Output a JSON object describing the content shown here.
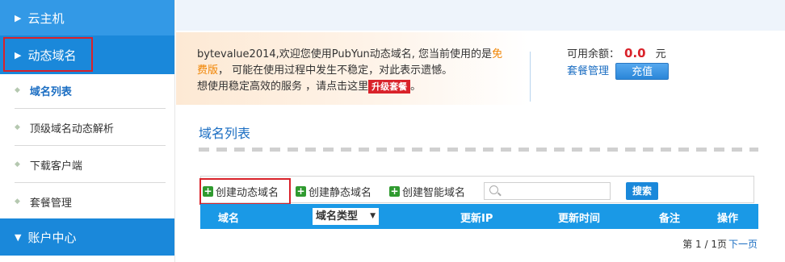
{
  "sidebar": {
    "groups": [
      {
        "label": "云主机",
        "expanded": false
      },
      {
        "label": "动态域名",
        "expanded": true
      },
      {
        "label": "账户中心",
        "expanded": true
      }
    ],
    "items": [
      {
        "label": "域名列表",
        "active": true
      },
      {
        "label": "顶级域名动态解析"
      },
      {
        "label": "下载客户端"
      },
      {
        "label": "套餐管理"
      }
    ]
  },
  "notice": {
    "line1_a": "bytevalue2014,欢迎您使用PubYun动态域名, 您当前使用的是",
    "line1_b": "免",
    "line2_a": "费版",
    "line2_b": "， 可能在使用过程中发生不稳定，对此表示遗憾。",
    "line3": "想使用稳定高效的服务 ，请点击这里",
    "upgrade": "升级套餐",
    "line3_end": "。"
  },
  "balance": {
    "label": "可用余额：",
    "amount": "0.0",
    "unit": "元",
    "plan_link": "套餐管理",
    "recharge": "充值"
  },
  "section": {
    "title": "域名列表"
  },
  "toolbar": {
    "create_dynamic": "创建动态域名",
    "create_static": "创建静态域名",
    "create_smart": "创建智能域名",
    "search_value": "",
    "search_button": "搜索"
  },
  "table": {
    "headers": {
      "domain": "域名",
      "type": "域名类型",
      "ip": "更新IP",
      "time": "更新时间",
      "note": "备注",
      "action": "操作"
    }
  },
  "pager": {
    "text": "第 1 / 1页",
    "next": "下一页"
  },
  "colors": {
    "nav_blue": "#1a88da",
    "highlight_red": "#d9222a",
    "link_blue": "#1a6dc2",
    "orange": "#f08300"
  }
}
